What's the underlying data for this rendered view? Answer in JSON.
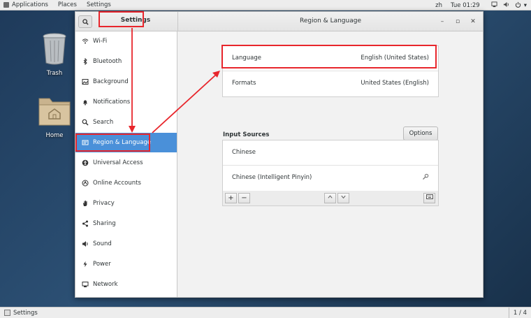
{
  "topbar": {
    "menus": [
      "Applications",
      "Places",
      "Settings"
    ],
    "keyboard": "zh",
    "clock": "Tue 01:29"
  },
  "desktop": {
    "trash_label": "Trash",
    "home_label": "Home"
  },
  "window": {
    "sidebar_title": "Settings",
    "panel_title": "Region & Language"
  },
  "sidebar": {
    "items": [
      {
        "label": "Wi-Fi",
        "icon": "wifi-icon"
      },
      {
        "label": "Bluetooth",
        "icon": "bluetooth-icon"
      },
      {
        "label": "Background",
        "icon": "background-icon"
      },
      {
        "label": "Notifications",
        "icon": "bell-icon"
      },
      {
        "label": "Search",
        "icon": "search-icon"
      },
      {
        "label": "Region & Language",
        "icon": "flag-icon",
        "active": true
      },
      {
        "label": "Universal Access",
        "icon": "accessibility-icon"
      },
      {
        "label": "Online Accounts",
        "icon": "cloud-icon"
      },
      {
        "label": "Privacy",
        "icon": "hand-icon"
      },
      {
        "label": "Sharing",
        "icon": "share-icon"
      },
      {
        "label": "Sound",
        "icon": "speaker-icon"
      },
      {
        "label": "Power",
        "icon": "power-icon"
      },
      {
        "label": "Network",
        "icon": "network-icon"
      }
    ]
  },
  "region": {
    "language_label": "Language",
    "language_value": "English (United States)",
    "formats_label": "Formats",
    "formats_value": "United States (English)"
  },
  "input_sources": {
    "header": "Input Sources",
    "options_label": "Options",
    "items": [
      "Chinese",
      "Chinese (Intelligent Pinyin)"
    ]
  },
  "taskbar": {
    "window_label": "Settings",
    "workspace": "1 / 4"
  },
  "colors": {
    "accent": "#4a90d9",
    "annotation": "#e8262c"
  }
}
